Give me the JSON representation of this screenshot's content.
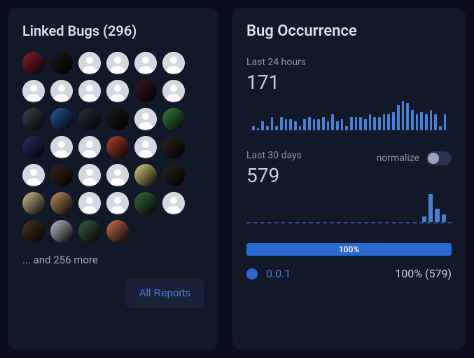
{
  "linked_bugs": {
    "title": "Linked Bugs (296)",
    "avatar_count": 40,
    "more_text": "... and 256 more",
    "all_reports_label": "All Reports",
    "avatar_variants": [
      "img1",
      "img2",
      "blank",
      "blank",
      "blank",
      "blank",
      "blank",
      "blank",
      "blank",
      "blank",
      "img3",
      "blank",
      "img4",
      "img5",
      "img6",
      "img7",
      "blank",
      "img8",
      "img9",
      "blank",
      "blank",
      "img10",
      "blank",
      "img11",
      "blank",
      "img12",
      "blank",
      "blank",
      "img13",
      "img14",
      "img15",
      "img16",
      "blank",
      "blank",
      "img17",
      "blank",
      "img18",
      "img19",
      "img20",
      "img21"
    ]
  },
  "bug_occurrence": {
    "title": "Bug Occurrence",
    "last_24h_label": "Last 24 hours",
    "last_24h_value": "171",
    "last_30d_label": "Last 30 days",
    "last_30d_value": "579",
    "normalize_label": "normalize",
    "progress_label": "100%",
    "version_label": "0.0.1",
    "version_stats": "100% (579)"
  },
  "chart_data": [
    {
      "type": "bar",
      "title": "Last 24 hours",
      "values": [
        4,
        2,
        8,
        4,
        12,
        4,
        12,
        10,
        10,
        8,
        4,
        10,
        12,
        10,
        10,
        12,
        8,
        14,
        8,
        10,
        4,
        12,
        12,
        12,
        10,
        14,
        12,
        12,
        14,
        14,
        16,
        22,
        26,
        24,
        18,
        14,
        16,
        14,
        18,
        14,
        4,
        14
      ]
    },
    {
      "type": "bar",
      "title": "Last 30 days",
      "values": [
        0,
        0,
        0,
        0,
        0,
        0,
        0,
        0,
        0,
        0,
        0,
        0,
        0,
        0,
        0,
        0,
        0,
        0,
        0,
        0,
        0,
        0,
        0,
        0,
        0,
        0,
        6,
        30,
        14,
        8
      ]
    }
  ],
  "avatar_colors": {
    "img1": "#8a2030",
    "img2": "#1a1a1a",
    "img3": "#3a1520",
    "img4": "#3a4550",
    "img5": "#2a5aa0",
    "img6": "#2a3040",
    "img7": "#1a1a1a",
    "img8": "#3a8040",
    "img9": "#2a3060",
    "img10": "#b54030",
    "img11": "#2a2520",
    "img12": "#3a2520",
    "img13": "#e0d080",
    "img14": "#2a2520",
    "img15": "#d0c090",
    "img16": "#c09060",
    "img17": "#3a7040",
    "img18": "#4a3520",
    "img19": "#c0c0d0",
    "img20": "#3a6040",
    "img21": "#d07050"
  }
}
